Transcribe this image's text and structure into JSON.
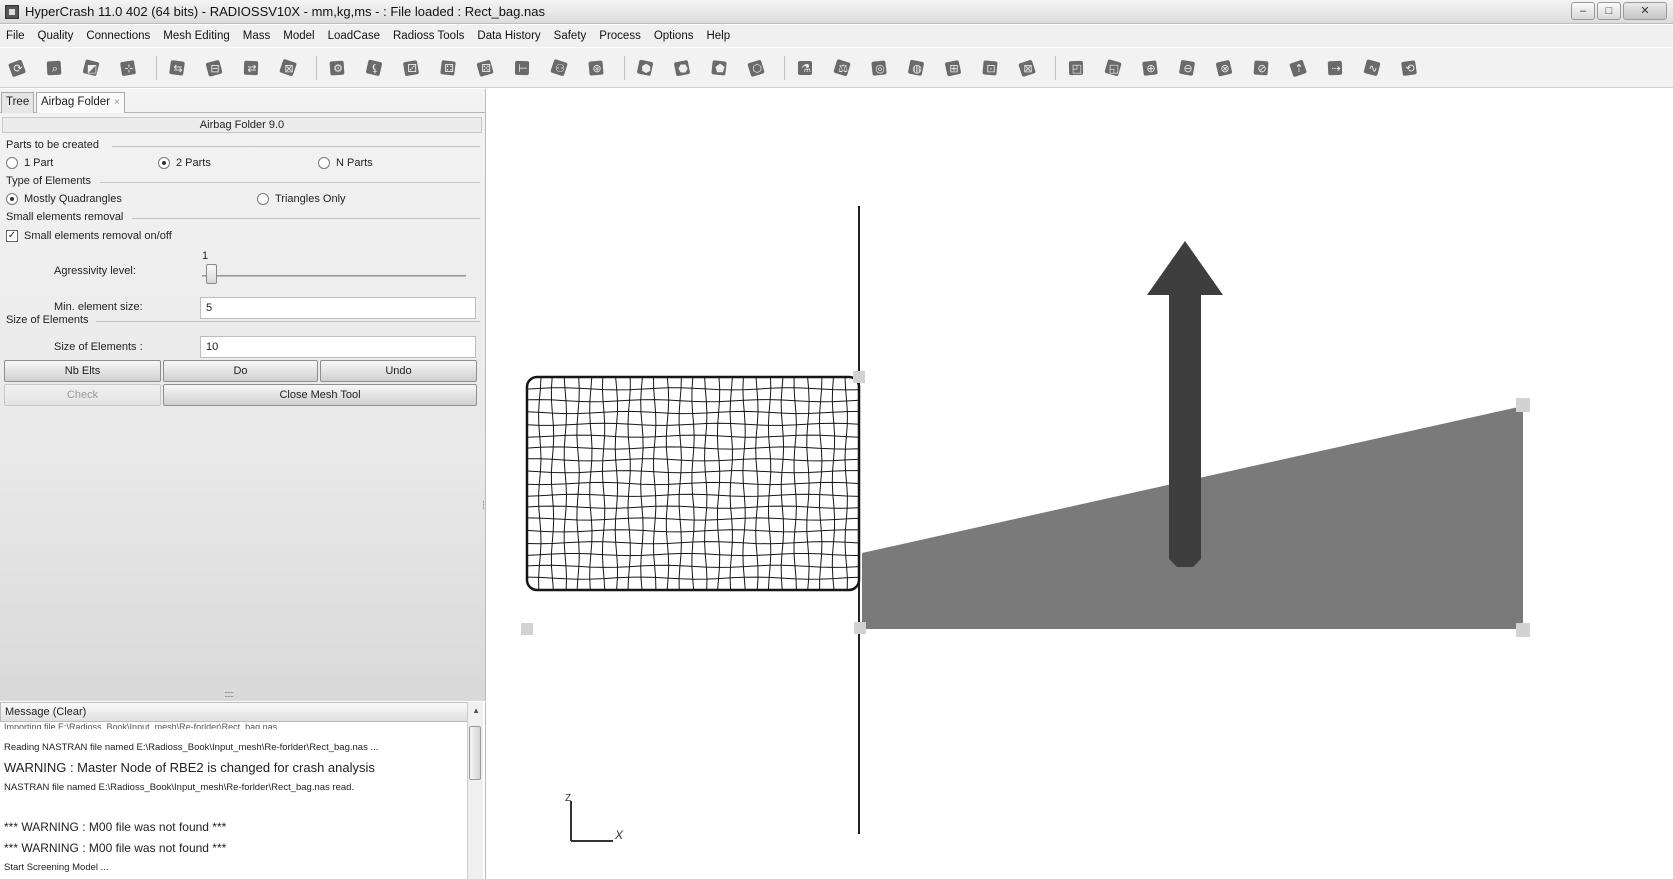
{
  "window": {
    "title": "HyperCrash 11.0 402 (64 bits) - RADIOSSV10X - mm,kg,ms - : File loaded : Rect_bag.nas",
    "controls": [
      "minimize-icon",
      "maximize-icon",
      "close-icon"
    ]
  },
  "menu": [
    "File",
    "Quality",
    "Connections",
    "Mesh Editing",
    "Mass",
    "Model",
    "LoadCase",
    "Radioss Tools",
    "Data History",
    "Safety",
    "Process",
    "Options",
    "Help"
  ],
  "toolbar_icons": [
    "refresh-icon",
    "zoom-icon",
    "select-icon",
    "node-icon",
    "part-tree-icon",
    "part-edit-icon",
    "part-copy-icon",
    "part-delete-icon",
    "mesh-tool-icon",
    "mesh-split-icon",
    "mesh-quad-icon",
    "mesh-tria-icon",
    "mesh-node-icon",
    "mesh-edge-icon",
    "mesh-free-icon",
    "mesh-check-icon",
    "solid-icon",
    "solid-mesh-icon",
    "solid-edit-icon",
    "solid-grid-icon",
    "material-icon",
    "property-icon",
    "weld-icon",
    "rivet-icon",
    "interface-icon",
    "contact-icon",
    "rigid-icon",
    "airbag-icon",
    "seatbelt-icon",
    "load-node-icon",
    "load-edit-icon",
    "load-move-icon",
    "load-fix-icon",
    "load-rotate-icon",
    "load-translate-icon",
    "spring-icon",
    "transform-icon"
  ],
  "tabs": {
    "tree": "Tree",
    "airbag": "Airbag Folder",
    "close_symbol": "×"
  },
  "panel": {
    "header": "Airbag Folder 9.0",
    "parts_group": "Parts to be created",
    "parts_options": [
      "1 Part",
      "2 Parts",
      "N Parts"
    ],
    "parts_selected": "2 Parts",
    "elements_group": "Type of Elements",
    "element_options": [
      "Mostly Quadrangles",
      "Triangles Only"
    ],
    "element_selected": "Mostly Quadrangles",
    "small_group": "Small elements removal",
    "small_checkbox": "Small elements removal on/off",
    "small_checked": true,
    "slider_value": "1",
    "aggressivity_label": "Agressivity level:",
    "aggressivity_fraction": 0.02,
    "min_size_label": "Min. element size:",
    "min_size_value": "5",
    "size_group": "Size of Elements",
    "size_label": "Size of Elements :",
    "size_value": "10",
    "buttons": {
      "nb_elts": "Nb Elts",
      "do": "Do",
      "undo": "Undo",
      "check": "Check",
      "close_mesh_tool": "Close Mesh Tool"
    },
    "grip": "::::::"
  },
  "messages": {
    "header": "Message (Clear)",
    "lines": [
      "Importing file E:\\Radioss_Book\\Input_mesh\\Re-forlder\\Rect_bag.nas",
      "Reading NASTRAN file named E:\\Radioss_Book\\Input_mesh\\Re-forlder\\Rect_bag.nas ...",
      "WARNING : Master Node of RBE2 is changed for crash analysis",
      "NASTRAN file named E:\\Radioss_Book\\Input_mesh\\Re-forlder\\Rect_bag.nas read.",
      "",
      "*** WARNING : M00 file was not found ***",
      "*** WARNING : M00 file was not found ***",
      "Start Screening Model ..."
    ]
  },
  "viewport": {
    "axis_z": "Z",
    "axis_x": "X",
    "colors": {
      "mesh": "#151515",
      "plate": "#7a7a7a",
      "arrow": "#3e3e3e",
      "node": "#d2d2d2"
    }
  }
}
